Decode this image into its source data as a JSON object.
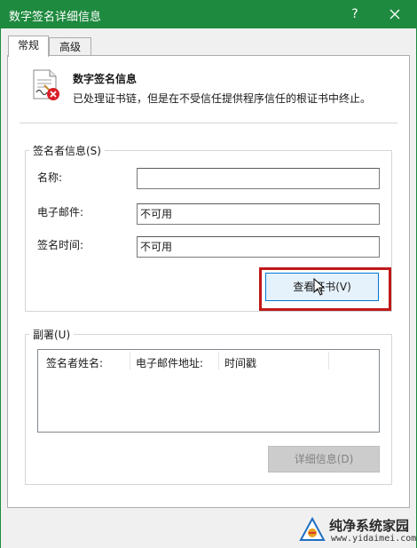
{
  "window": {
    "title": "数字签名详细信息",
    "help_label": "?",
    "titlebar_color": "#1e8a3f"
  },
  "tabs": [
    {
      "label": "常规",
      "active": true
    },
    {
      "label": "高级",
      "active": false
    }
  ],
  "info": {
    "icon": "certificate-error-icon",
    "title": "数字签名信息",
    "description": "已处理证书链，但是在不受信任提供程序信任的根证书中终止。"
  },
  "signer_group": {
    "label": "签名者信息(S)",
    "fields": [
      {
        "label": "名称:",
        "value": ""
      },
      {
        "label": "电子邮件:",
        "value": "不可用"
      },
      {
        "label": "签名时间:",
        "value": "不可用"
      }
    ],
    "view_cert_button": "查看证书(V)"
  },
  "countersig_group": {
    "label": "副署(U)",
    "columns": [
      "签名者姓名:",
      "电子邮件地址:",
      "时间戳"
    ],
    "details_button": "详细信息(D)"
  },
  "watermark": {
    "text": "纯净系统家园",
    "url": "www.yidaimei.com"
  },
  "colors": {
    "accent_blue": "#0078d7",
    "highlight_red": "#c0191a"
  }
}
